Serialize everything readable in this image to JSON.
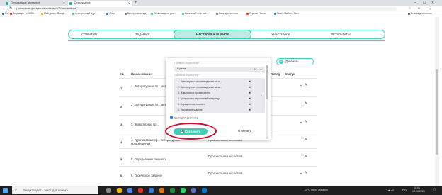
{
  "browser": {
    "tabs": [
      {
        "label": "Оплонкадное дерхвание",
        "active": false
      },
      {
        "label": "Оплонкадное",
        "active": true
      }
    ],
    "new_tab": "+",
    "url": "olimp.kodir.gov.spb.ru/event/view/405?tab=settings",
    "bookmarks": [
      {
        "label": "ОК",
        "color": "#1a73e8"
      },
      {
        "label": "Входящие - m3895...",
        "color": "#d93025"
      },
      {
        "label": "Мой диск – Google...",
        "color": "#f4b400"
      },
      {
        "label": "Электронный жур...",
        "color": "#3ccfb5"
      },
      {
        "label": "VKAq",
        "color": "#4a76a8"
      },
      {
        "label": "Центр олимпиад",
        "color": "#777"
      },
      {
        "label": "Олимпиадное дви...",
        "color": "#3ccfb5"
      },
      {
        "label": "Школьный этап все...",
        "color": "#3ccfb5"
      },
      {
        "label": "Банк документов",
        "color": "#777"
      },
      {
        "label": "Яндекс. Почта",
        "color": "#fc3f1d"
      },
      {
        "label": "Почта Mail.ru – Бан...",
        "color": "#168de2"
      },
      {
        "label": "Список для чтения",
        "color": "#555"
      }
    ]
  },
  "nav": {
    "tabs": [
      {
        "label": "СОБЫТИЯ",
        "active": false
      },
      {
        "label": "ЗАДАНИЯ",
        "active": false
      },
      {
        "label": "НАСТРОЙКА ОЦЕНОК",
        "active": true
      },
      {
        "label": "УЧАСТНИКИ",
        "active": false
      },
      {
        "label": "РЕЗУЛЬТАТЫ",
        "active": false
      }
    ]
  },
  "add_button": {
    "label": "Добавить"
  },
  "table": {
    "headers": {
      "num": "№",
      "name": "Наименование",
      "rating": "Rating",
      "status": "Статус"
    },
    "rows": [
      {
        "num": "1",
        "name": "1. Литературные пр... авторы",
        "type": ""
      },
      {
        "num": "2",
        "name": "2. Литературные пр... авторы",
        "type": ""
      },
      {
        "num": "3",
        "name": "3. Живописные пр...",
        "type": ""
      },
      {
        "num": "4",
        "name": "4. Группировка пер... литературных произведений",
        "type": "Произвольная числовая"
      },
      {
        "num": "5",
        "name": "5. Определение пешнего",
        "type": "Произвольная числовая"
      },
      {
        "num": "6",
        "name": "6. Творческое задание",
        "type": "Произвольная числовая"
      }
    ]
  },
  "modal": {
    "label_type": "Правило обработки *",
    "type_value": "Сумма",
    "label_scores": "Оценки в обработку *",
    "chips": [
      "1. Литературные произведения и на за...",
      "2. Литературные произведения и на за...",
      "3. Живописные произведения",
      "4. Группировка персонажей литератур...",
      "5. Определение лишнего",
      "6. Творческое задание"
    ],
    "checkbox_label": "Балл для рейтинга",
    "save_label": "Сохранить",
    "cancel_label": "Отменить"
  },
  "taskbar": {
    "search_placeholder": "Введите здесь текст для поиска",
    "weather": "10°C Ясно, облачно",
    "time": "10:01",
    "date": "02.09.2021",
    "lang": "РУС"
  },
  "colors": {
    "accent": "#3ccfb5",
    "highlight_ring": "#c8102e",
    "taskbar": "#202020"
  }
}
